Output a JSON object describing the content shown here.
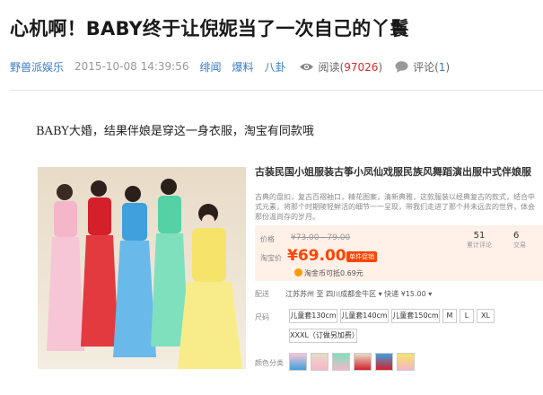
{
  "article": {
    "title": "心机啊！BABY终于让倪妮当了一次自己的丫鬟",
    "source": "野兽派娱乐",
    "date": "2015-10-08 14:39:56",
    "categories": [
      "绯闻",
      "爆料",
      "八卦"
    ],
    "views_label": "阅读",
    "views_open": "(",
    "views_count": "97026",
    "views_close": ")",
    "comments_label": "评论",
    "comments_open": "(",
    "comments_count": "1",
    "comments_close": ")",
    "lead": "BABY大婚，结果伴娘是穿这一身衣服，淘宝有同款哦"
  },
  "product": {
    "title": "古装民国小姐服装古筝小凤仙戏服民族风舞蹈演出服中式伴娘服",
    "desc": "古典的盘扣，复古百褶袖口，精花图案，清新典雅，这款服装以经典复古的款式，结合中式元素，将那个时期陵轻鲜活的细节一一呈现，带我们走进了那个并未远去的世界，体会那份温尚存的岁月。",
    "price_label": "价格",
    "original_price": "¥73.00 - 79.00",
    "promo_label": "淘宝价",
    "current_price": "¥69.00",
    "promo_tag": "单件促销",
    "sales_count": "51",
    "sales_label": "累计评论",
    "sales2_count": "6",
    "sales2_label": "交易",
    "coin_text": "淘金币可抵0.69元",
    "ship_label": "配送",
    "ship_text": "江苏苏州 至  四川成都金牛区 ▾  快递 ¥15.00 ▾",
    "size_label": "尺码",
    "sizes": [
      "儿童套130cm",
      "儿童套140cm",
      "儿童套150cm",
      "M",
      "L",
      "XL"
    ],
    "size_extra": "XXXL（订做另加费）",
    "color_label": "颜色分类"
  },
  "colors": {
    "accent_blue": "#3a7dc9",
    "red": "#d92b2b",
    "price_orange": "#ff4400"
  }
}
